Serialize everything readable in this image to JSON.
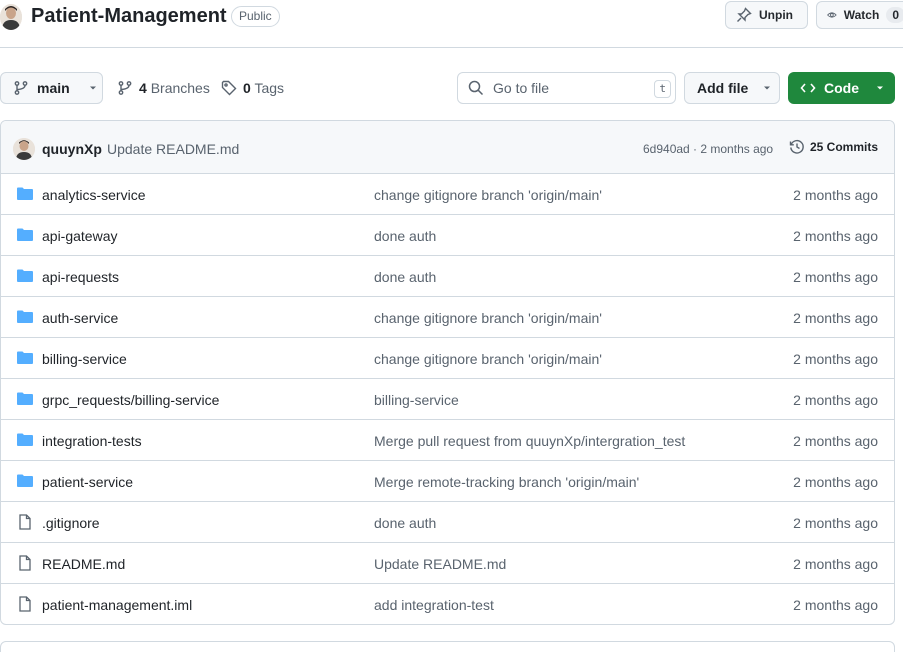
{
  "repo": {
    "name": "Patient-Management",
    "visibility": "Public",
    "unpin_label": "Unpin",
    "watch_label": "Watch",
    "watch_count": "0"
  },
  "toolbar": {
    "branch": "main",
    "branches_count": "4",
    "branches_label": "Branches",
    "tags_count": "0",
    "tags_label": "Tags",
    "search_placeholder": "Go to file",
    "search_shortcut": "t",
    "add_file_label": "Add file",
    "code_label": "Code"
  },
  "latest_commit": {
    "author": "quuynXp",
    "message": "Update README.md",
    "hash_and_time": "6d940ad · 2 months ago",
    "commits_label": "25 Commits"
  },
  "files": [
    {
      "type": "folder",
      "name": "analytics-service",
      "commit": "change gitignore branch 'origin/main'",
      "date": "2 months ago"
    },
    {
      "type": "folder",
      "name": "api-gateway",
      "commit": "done auth",
      "date": "2 months ago"
    },
    {
      "type": "folder",
      "name": "api-requests",
      "commit": "done auth",
      "date": "2 months ago"
    },
    {
      "type": "folder",
      "name": "auth-service",
      "commit": "change gitignore branch 'origin/main'",
      "date": "2 months ago"
    },
    {
      "type": "folder",
      "name": "billing-service",
      "commit": "change gitignore branch 'origin/main'",
      "date": "2 months ago"
    },
    {
      "type": "folder",
      "name": "grpc_requests/billing-service",
      "commit": "billing-service",
      "date": "2 months ago"
    },
    {
      "type": "folder",
      "name": "integration-tests",
      "commit": "Merge pull request from quuynXp/intergration_test",
      "date": "2 months ago"
    },
    {
      "type": "folder",
      "name": "patient-service",
      "commit": "Merge remote-tracking branch 'origin/main'",
      "date": "2 months ago"
    },
    {
      "type": "file",
      "name": ".gitignore",
      "commit": "done auth",
      "date": "2 months ago"
    },
    {
      "type": "file",
      "name": "README.md",
      "commit": "Update README.md",
      "date": "2 months ago"
    },
    {
      "type": "file",
      "name": "patient-management.iml",
      "commit": "add integration-test",
      "date": "2 months ago"
    }
  ],
  "colors": {
    "folder": "#54aeff",
    "file": "#59636e",
    "code_button": "#1f883d",
    "border": "#d1d9e0"
  }
}
